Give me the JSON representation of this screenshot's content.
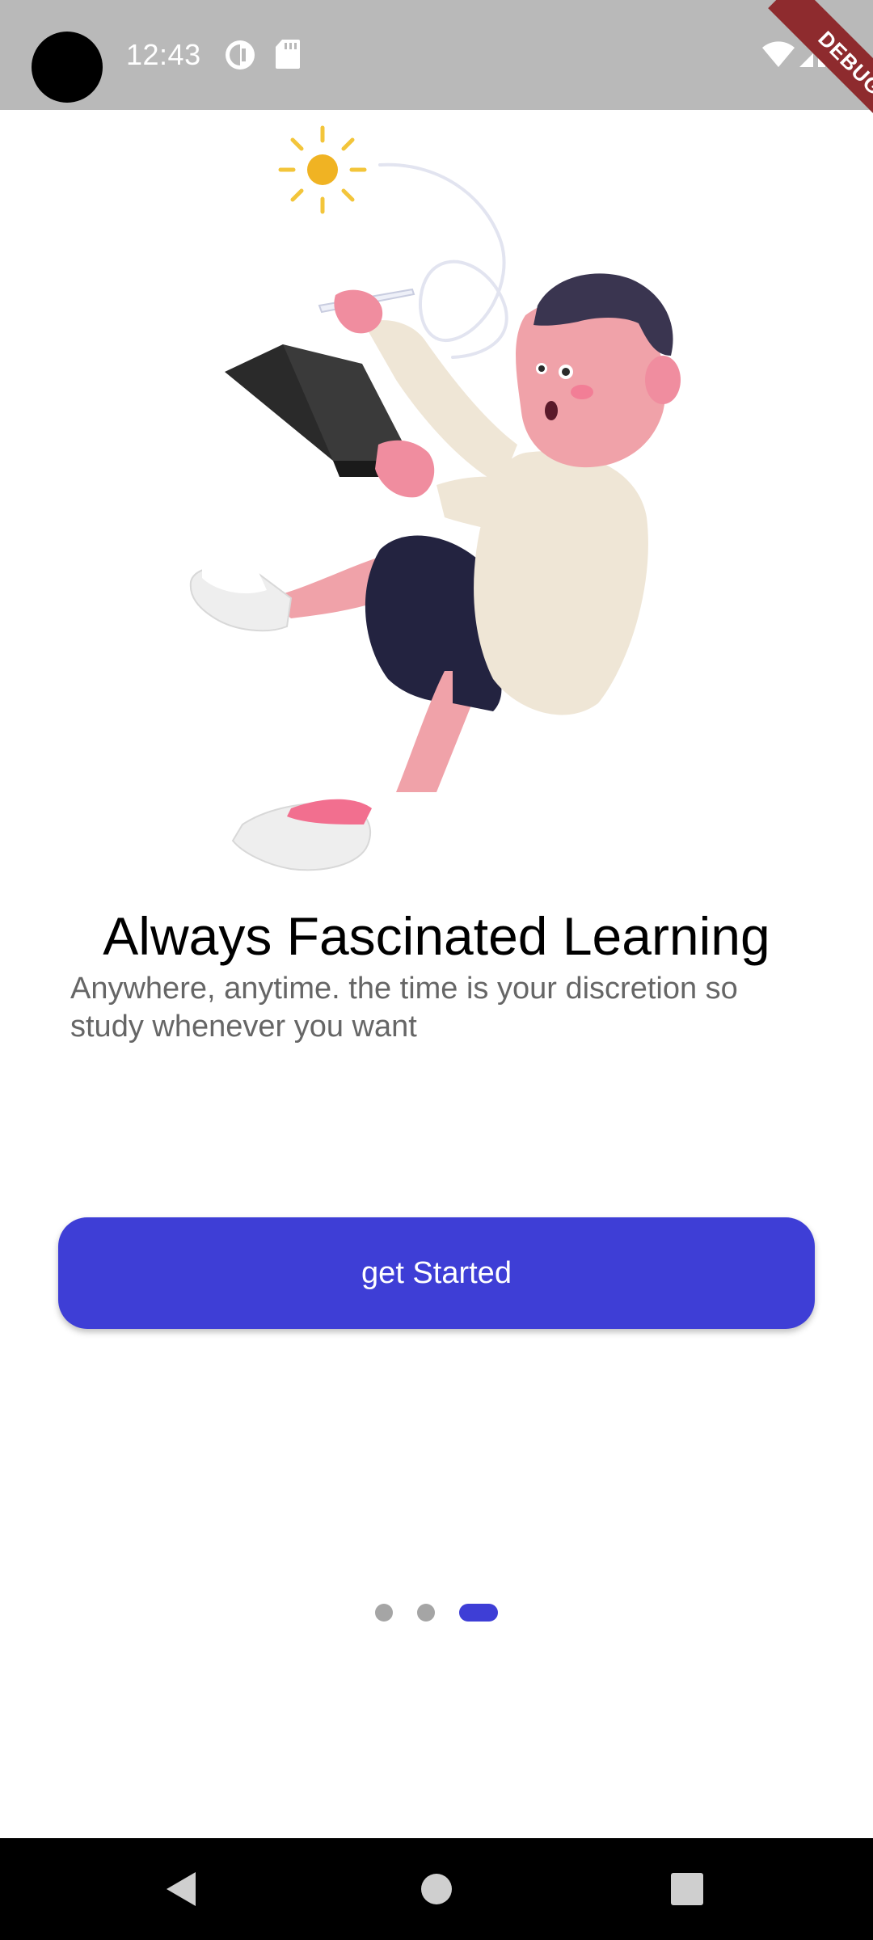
{
  "status_bar": {
    "time": "12:43",
    "icons": [
      "circle-notification-icon",
      "sd-card-icon",
      "wifi-icon",
      "signal-icon",
      "battery-icon"
    ]
  },
  "debug_banner": {
    "label": "DEBUG",
    "color": "#8e2b2e"
  },
  "onboarding": {
    "illustration": "boy-with-tablet-illustration",
    "title": "Always Fascinated Learning",
    "subtitle": "Anywhere, anytime. the time is your discretion so study whenever you want",
    "cta_label": "get Started",
    "page_count": 3,
    "active_page": 3
  },
  "nav_bar": {
    "icons": [
      "back-icon",
      "home-icon",
      "recents-icon"
    ]
  },
  "colors": {
    "accent": "#3e3ed6",
    "status_bar": "#b9b9b9",
    "inactive_dot": "#a5a5a5"
  }
}
